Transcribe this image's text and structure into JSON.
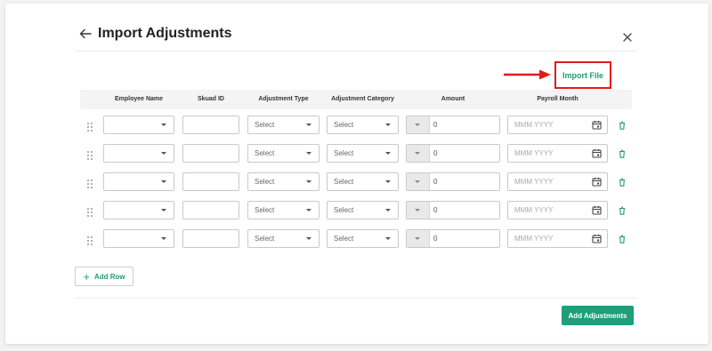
{
  "header": {
    "title": "Import Adjustments"
  },
  "import_file_label": "Import File",
  "columns": [
    "Employee Name",
    "Skuad ID",
    "Adjustment Type",
    "Adjustment Category",
    "Amount",
    "Payroll Month"
  ],
  "rows": [
    {
      "employee": "",
      "skuad_id": "",
      "type": "Select",
      "category": "Select",
      "amount": "0",
      "month_placeholder": "MMM YYYY"
    },
    {
      "employee": "",
      "skuad_id": "",
      "type": "Select",
      "category": "Select",
      "amount": "0",
      "month_placeholder": "MMM YYYY"
    },
    {
      "employee": "",
      "skuad_id": "",
      "type": "Select",
      "category": "Select",
      "amount": "0",
      "month_placeholder": "MMM YYYY"
    },
    {
      "employee": "",
      "skuad_id": "",
      "type": "Select",
      "category": "Select",
      "amount": "0",
      "month_placeholder": "MMM YYYY"
    },
    {
      "employee": "",
      "skuad_id": "",
      "type": "Select",
      "category": "Select",
      "amount": "0",
      "month_placeholder": "MMM YYYY"
    }
  ],
  "add_row_label": "Add Row",
  "add_adjustments_label": "Add Adjustments",
  "colors": {
    "accent": "#1e9e79",
    "highlight": "#e01b1b"
  },
  "icons": [
    "back-arrow-icon",
    "close-icon",
    "drag-handle-icon",
    "chevron-down-icon",
    "calendar-icon",
    "trash-icon",
    "plus-icon",
    "red-arrow-icon"
  ]
}
